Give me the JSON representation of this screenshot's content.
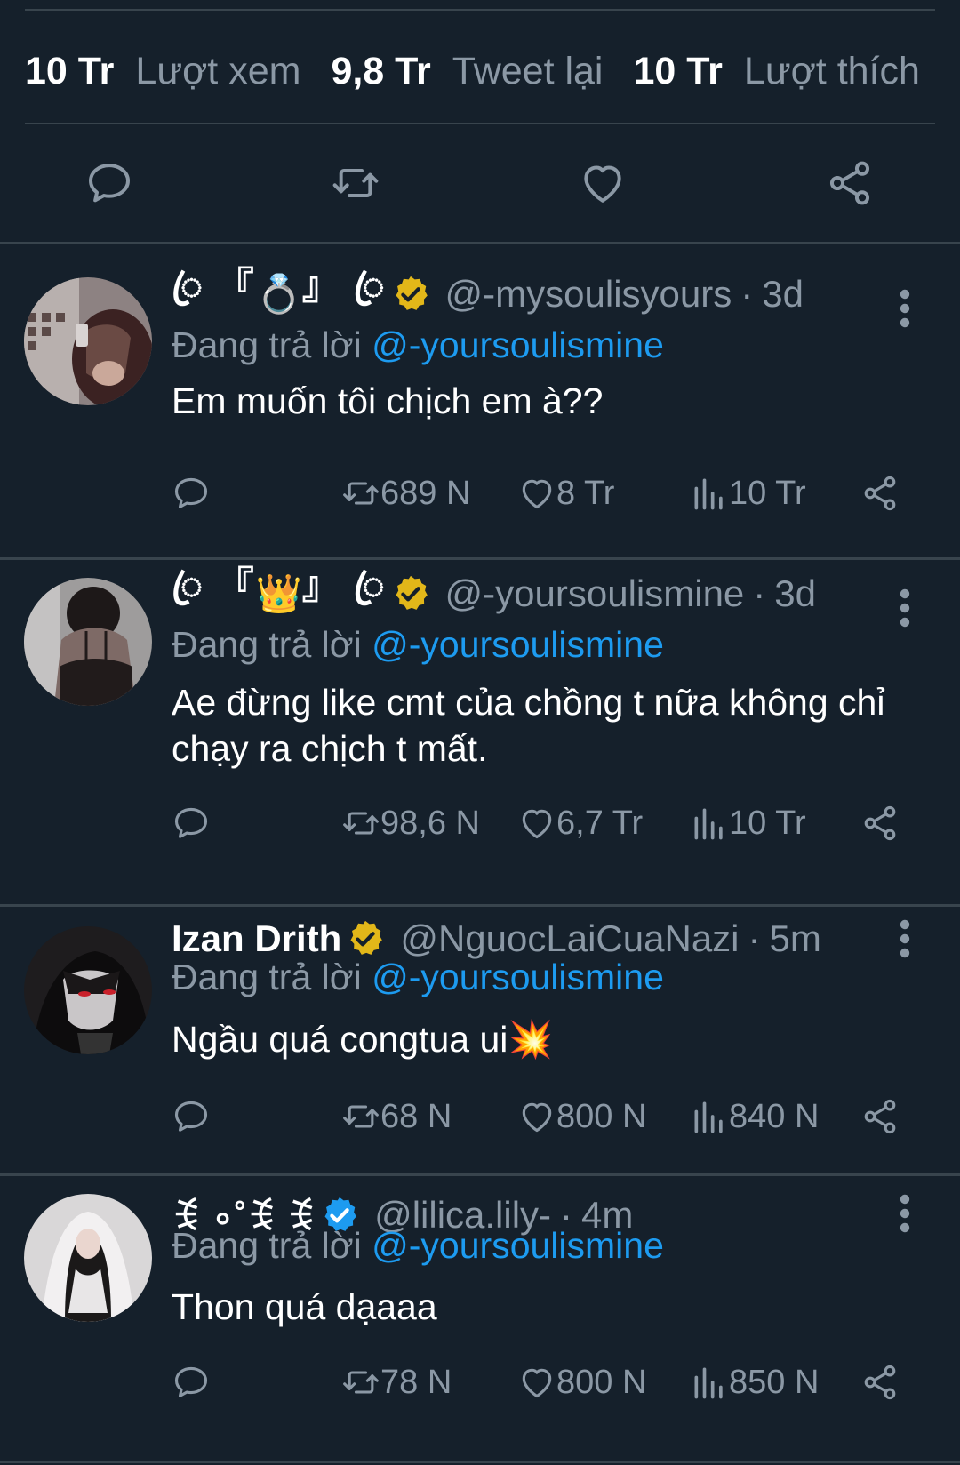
{
  "stats": {
    "views_num": "10 Tr",
    "views_label": "Lượt xem",
    "retweets_num": "9,8 Tr",
    "retweets_label": "Tweet lại",
    "likes_num": "10 Tr",
    "likes_label": "Lượt thích"
  },
  "replies": [
    {
      "display_name_left": "ꦿ 『",
      "display_name_emoji": "💍",
      "display_name_right": "』 ꦿ",
      "verified": "gold",
      "handle": "@-mysoulisyours",
      "time": "3d",
      "replying_prefix": "Đang trả lời",
      "replying_to": "@-yoursoulismine",
      "text": "Em muốn tôi chịch em à??",
      "retweets": "689 N",
      "likes": "8 Tr",
      "views": "10 Tr"
    },
    {
      "display_name_left": "ꦿ 『",
      "display_name_emoji": "👑",
      "display_name_right": "』 ꦿ",
      "verified": "gold",
      "handle": "@-yoursoulismine",
      "time": "3d",
      "replying_prefix": "Đang trả lời",
      "replying_to": "@-yoursoulismine",
      "text": "Ae đừng like cmt của chồng t nữa không chỉ chạy ra chịch t mất.",
      "retweets": "98,6 N",
      "likes": "6,7 Tr",
      "views": "10 Tr"
    },
    {
      "display_name": "Izan Drith",
      "verified": "gold",
      "handle": "@NguocLaiCuaNazi",
      "time": "5m",
      "replying_prefix": "Đang trả lời",
      "replying_to": "@-yoursoulismine",
      "text": "Ngầu quá congtua ui💥",
      "retweets": "68 N",
      "likes": "800 N",
      "views": "840 N"
    },
    {
      "display_name": "ꉂ ∘˚ꉂ ꉂ",
      "verified": "blue",
      "handle": "@lilica.lily-",
      "time": "4m",
      "replying_prefix": "Đang trả lời",
      "replying_to": "@-yoursoulismine",
      "text": "Thon quá dạaaa",
      "retweets": "78 N",
      "likes": "800 N",
      "views": "850 N"
    }
  ],
  "colors": {
    "background": "#15202b",
    "divider": "#38444d",
    "secondary_text": "#8b98a5",
    "mention": "#1d9bf0",
    "verified_gold": "#e2b719",
    "verified_blue": "#1d9bf0"
  },
  "icons": {
    "action_bar": [
      "reply-icon",
      "retweet-icon",
      "like-icon",
      "share-icon"
    ],
    "tweet_metrics": [
      "reply-icon",
      "retweet-icon",
      "like-icon",
      "views-icon",
      "share-icon"
    ],
    "more": "more-vertical-icon"
  }
}
